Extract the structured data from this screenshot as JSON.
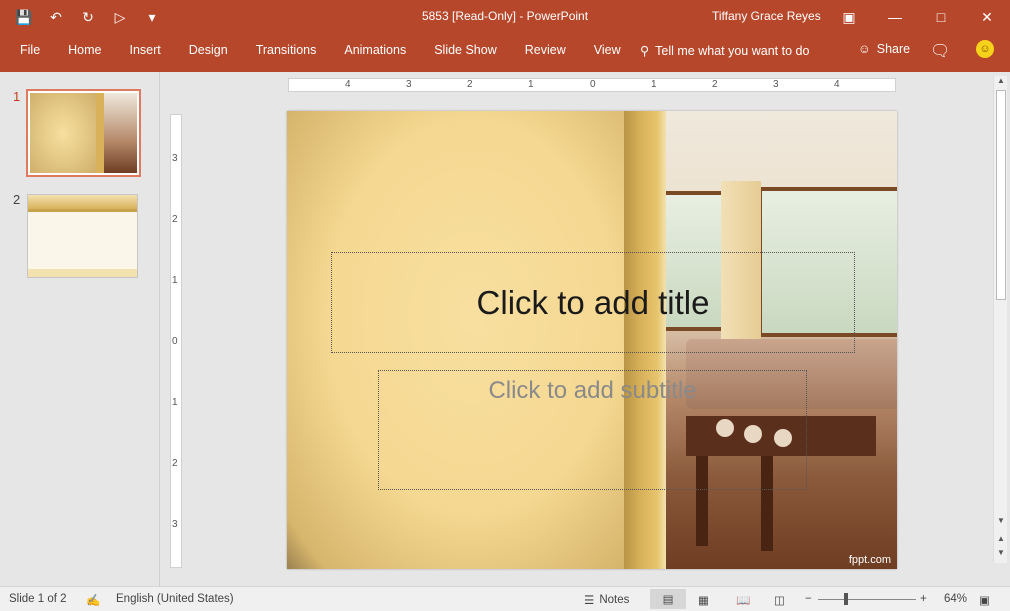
{
  "window": {
    "title": "5853 [Read-Only]  -  PowerPoint",
    "user": "Tiffany Grace Reyes"
  },
  "ribbon": {
    "tabs": [
      "File",
      "Home",
      "Insert",
      "Design",
      "Transitions",
      "Animations",
      "Slide Show",
      "Review",
      "View"
    ],
    "tell_me": "Tell me what you want to do",
    "share": "Share"
  },
  "thumbnails": [
    {
      "number": "1",
      "active": true
    },
    {
      "number": "2",
      "active": false
    }
  ],
  "ruler": {
    "horizontal": [
      "4",
      "3",
      "2",
      "1",
      "0",
      "1",
      "2",
      "3",
      "4"
    ],
    "vertical": [
      "3",
      "2",
      "1",
      "0",
      "1",
      "2",
      "3"
    ]
  },
  "slide": {
    "title_placeholder": "Click to add title",
    "subtitle_placeholder": "Click to add subtitle",
    "brand": "fppt.com"
  },
  "status": {
    "slide_info": "Slide 1 of 2",
    "language": "English (United States)",
    "notes": "Notes",
    "zoom": "64%"
  }
}
